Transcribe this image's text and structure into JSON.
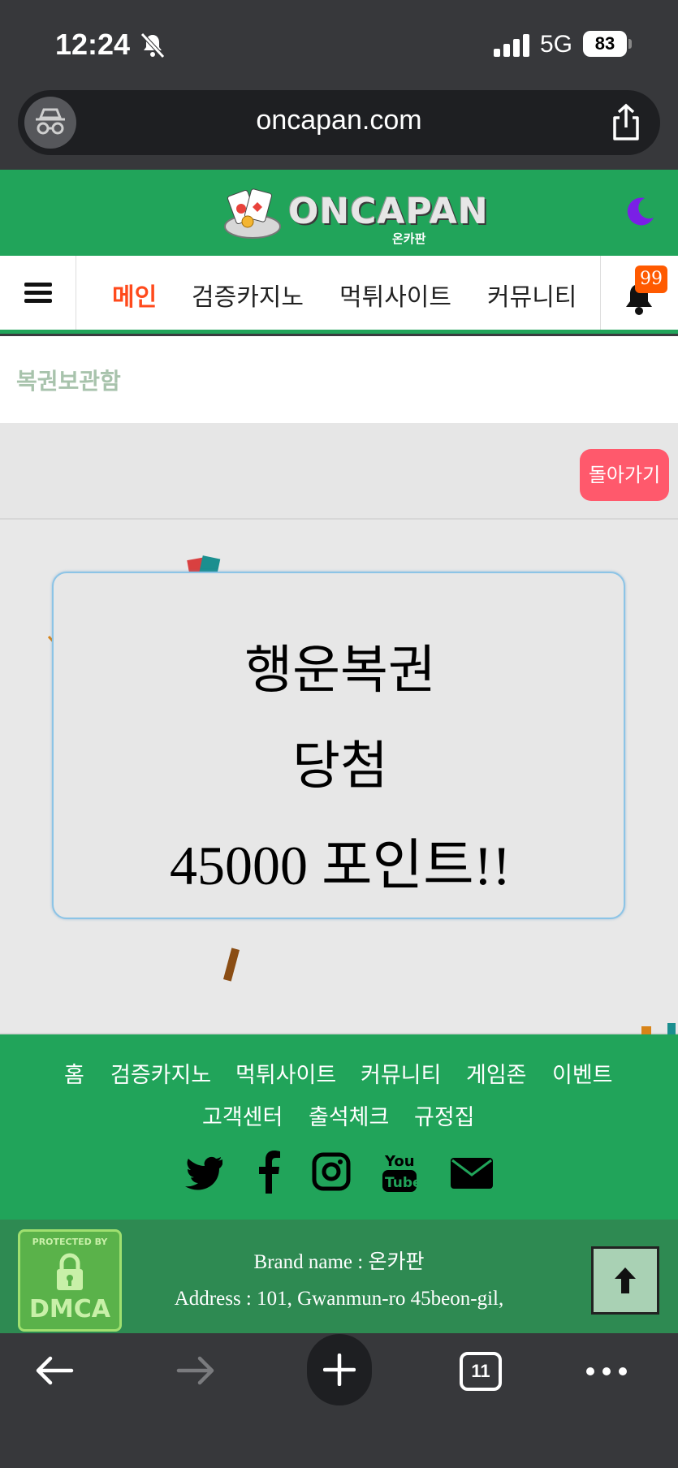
{
  "status": {
    "time": "12:24",
    "network": "5G",
    "battery": "83"
  },
  "browser": {
    "url": "oncapan.com",
    "tab_count": "11"
  },
  "header": {
    "brand": "ONCAPAN",
    "brand_sub": "온카판"
  },
  "nav": {
    "items": [
      "메인",
      "검증카지노",
      "먹튀사이트",
      "커뮤니티"
    ],
    "active_index": 0,
    "notification_count": "99"
  },
  "page": {
    "title": "복권보관함",
    "back_label": "돌아가기"
  },
  "lotto": {
    "line1": "행운복권",
    "line2": "당첨",
    "line3": "45000 포인트!!"
  },
  "footer": {
    "links_row1": [
      "홈",
      "검증카지노",
      "먹튀사이트",
      "커뮤니티",
      "게임존",
      "이벤트"
    ],
    "links_row2": [
      "고객센터",
      "출석체크",
      "규정집"
    ],
    "social": [
      "twitter-icon",
      "facebook-icon",
      "instagram-icon",
      "youtube-icon",
      "email-icon"
    ],
    "dmca_top": "PROTECTED BY",
    "dmca_label": "DMCA",
    "brand_line": "Brand name : 온카판",
    "address_line": "Address : 101, Gwanmun-ro 45beon-gil,"
  },
  "colors": {
    "brand_green": "#21a45a",
    "active_nav": "#ff4a1c",
    "back_button": "#ff596c",
    "badge": "#ff5a00"
  }
}
